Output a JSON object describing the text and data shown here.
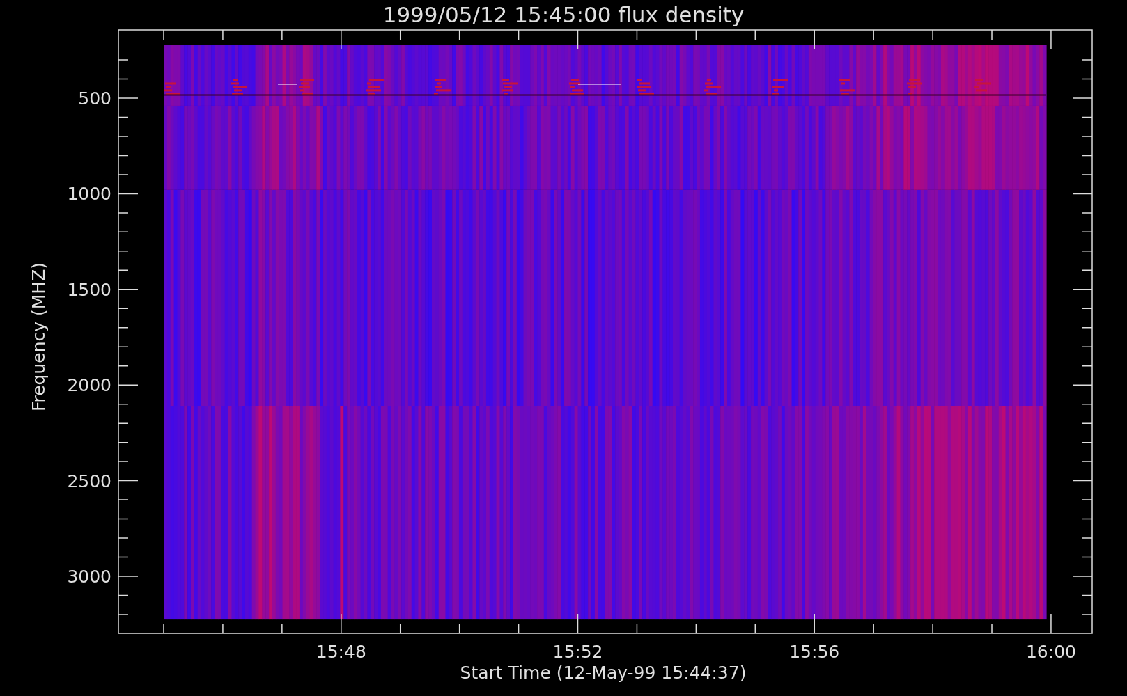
{
  "title": "1999/05/12 15:45:00 flux density",
  "y_axis": {
    "label": "Frequency (MHZ)",
    "ticks": [
      "500",
      "1000",
      "1500",
      "2000",
      "2500",
      "3000"
    ]
  },
  "x_axis": {
    "label": "Start Time (12-May-99 15:44:37)",
    "ticks": [
      "15:48",
      "15:52",
      "15:56",
      "16:00"
    ]
  }
}
